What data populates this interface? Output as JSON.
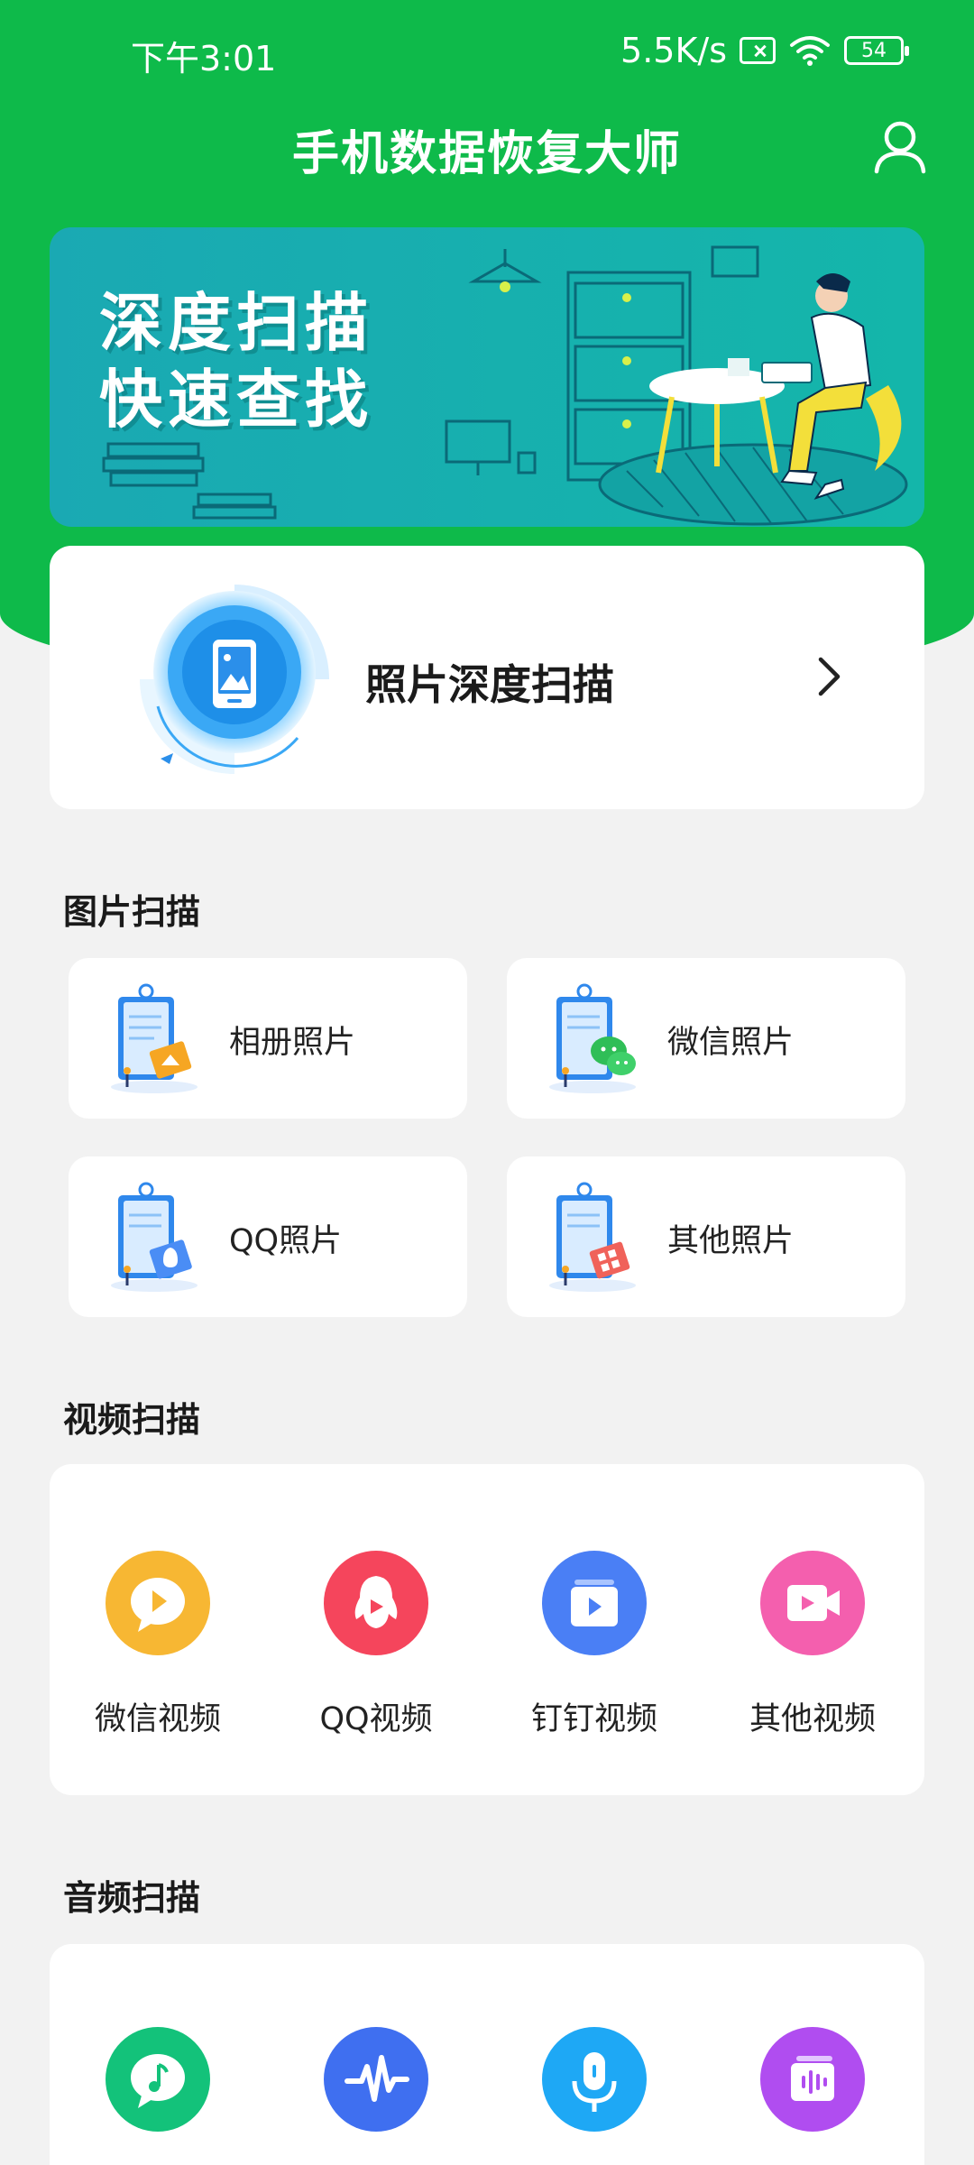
{
  "status_bar": {
    "time": "下午3:01",
    "net_speed": "5.5K/s",
    "battery": "54"
  },
  "header": {
    "title": "手机数据恢复大师"
  },
  "banner": {
    "line1": "深度扫描",
    "line2": "快速查找"
  },
  "deep_scan": {
    "label": "照片深度扫描"
  },
  "image_scan": {
    "title": "图片扫描",
    "items": [
      {
        "label": "相册照片",
        "icon": "album-photo-icon"
      },
      {
        "label": "微信照片",
        "icon": "wechat-photo-icon"
      },
      {
        "label": "QQ照片",
        "icon": "qq-photo-icon"
      },
      {
        "label": "其他照片",
        "icon": "other-photo-icon"
      }
    ]
  },
  "video_scan": {
    "title": "视频扫描",
    "items": [
      {
        "label": "微信视频",
        "icon": "wechat-video-icon",
        "color": "#f7b733"
      },
      {
        "label": "QQ视频",
        "icon": "qq-video-icon",
        "color": "#f5455c"
      },
      {
        "label": "钉钉视频",
        "icon": "dingtalk-video-icon",
        "color": "#4a7ff5"
      },
      {
        "label": "其他视频",
        "icon": "other-video-icon",
        "color": "#f45fae"
      }
    ]
  },
  "audio_scan": {
    "title": "音频扫描",
    "items": [
      {
        "icon": "wechat-audio-icon",
        "color": "#13c27a"
      },
      {
        "icon": "waveform-audio-icon",
        "color": "#3f6ff0"
      },
      {
        "icon": "microphone-audio-icon",
        "color": "#1ea8f5"
      },
      {
        "icon": "other-audio-icon",
        "color": "#b04df0"
      }
    ]
  },
  "colors": {
    "brand_green": "#0eba4a",
    "banner_teal": "#15b0ad",
    "page_bg": "#f2f2f2"
  }
}
